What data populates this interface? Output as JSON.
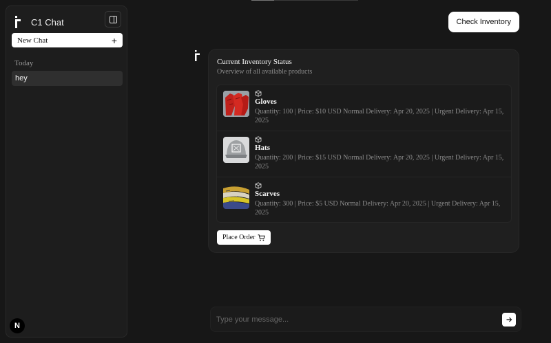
{
  "sidebar": {
    "title": "C1 Chat",
    "new_chat_label": "New Chat",
    "section_label": "Today",
    "history": [
      "hey"
    ],
    "user_initial": "N"
  },
  "conversation": {
    "user_message": "Check Inventory",
    "card": {
      "title": "Current Inventory Status",
      "subtitle": "Overview of all available products",
      "items": [
        {
          "name": "Gloves",
          "description": "Quantity: 100 | Price: $10 USD Normal Delivery: Apr 20, 2025 | Urgent Delivery: Apr 15, 2025"
        },
        {
          "name": "Hats",
          "description": "Quantity: 200 | Price: $15 USD Normal Delivery: Apr 20, 2025 | Urgent Delivery: Apr 15, 2025"
        },
        {
          "name": "Scarves",
          "description": "Quantity: 300 | Price: $5 USD Normal Delivery: Apr 20, 2025 | Urgent Delivery: Apr 15, 2025"
        }
      ],
      "action_label": "Place Order"
    }
  },
  "composer": {
    "placeholder": "Type your message..."
  },
  "icons": {
    "brand": "c1-logo-icon",
    "collapse": "sidebar-toggle-icon",
    "new_chat": "plus-icon",
    "item": "package-icon",
    "order": "cart-icon",
    "send": "arrow-right-icon"
  }
}
